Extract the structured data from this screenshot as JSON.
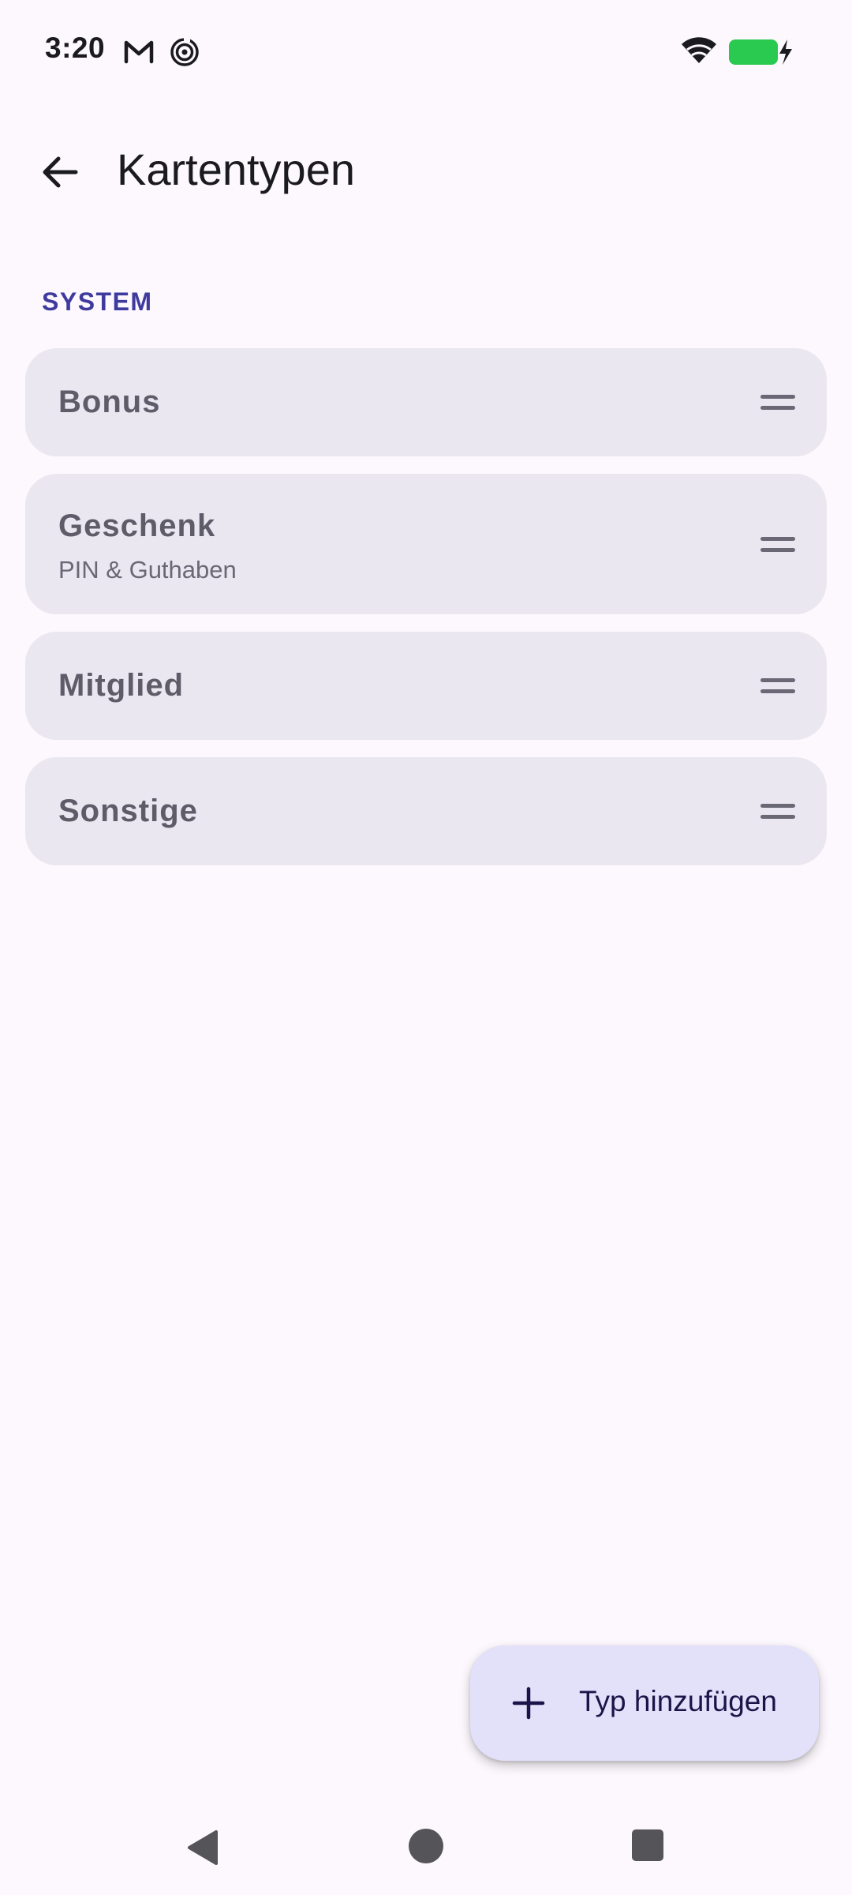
{
  "status_bar": {
    "time": "3:20",
    "icons": [
      "gmail-icon",
      "sync-icon",
      "wifi-icon",
      "battery-charging-icon"
    ],
    "battery_color": "#2ac94f"
  },
  "app_bar": {
    "title": "Kartentypen",
    "back_icon": "arrow-back-icon"
  },
  "section": {
    "header": "SYSTEM",
    "header_color": "#3f3a9e"
  },
  "card_types": [
    {
      "title": "Bonus"
    },
    {
      "title": "Geschenk",
      "subtitle": "PIN & Guthaben"
    },
    {
      "title": "Mitglied"
    },
    {
      "title": "Sonstige"
    }
  ],
  "fab": {
    "label": "Typ hinzufügen",
    "icon": "plus-icon"
  },
  "nav_bar": {
    "icons": [
      "nav-back-icon",
      "nav-home-icon",
      "nav-recents-icon"
    ]
  },
  "colors": {
    "background": "#fcf8fd",
    "list_item": "#eae7f1",
    "fab": "#e3e0fa"
  }
}
